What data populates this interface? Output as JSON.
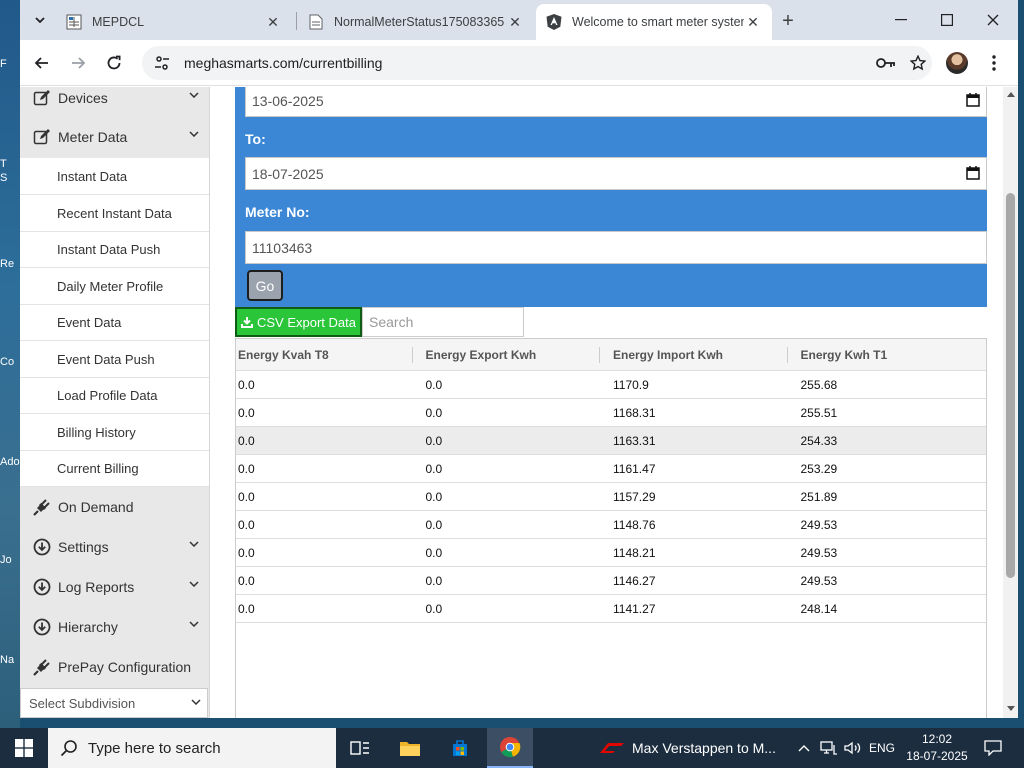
{
  "browser": {
    "tabs": [
      {
        "title": "MEPDCL"
      },
      {
        "title": "NormalMeterStatus175083365"
      },
      {
        "title": "Welcome to smart meter system"
      }
    ],
    "url": "meghasmarts.com/currentbilling"
  },
  "sidebar": {
    "items_top": [
      {
        "label": "Devices",
        "icon": "edit-icon"
      },
      {
        "label": "Meter Data",
        "icon": "edit-icon"
      }
    ],
    "submenu": [
      {
        "label": "Instant Data"
      },
      {
        "label": "Recent Instant Data"
      },
      {
        "label": "Instant Data Push"
      },
      {
        "label": "Daily Meter Profile"
      },
      {
        "label": "Event Data"
      },
      {
        "label": "Event Data Push"
      },
      {
        "label": "Load Profile Data"
      },
      {
        "label": "Billing History"
      },
      {
        "label": "Current Billing"
      }
    ],
    "items_bottom": [
      {
        "label": "On Demand",
        "icon": "plug-icon"
      },
      {
        "label": "Settings",
        "icon": "download-circle-icon"
      },
      {
        "label": "Log Reports",
        "icon": "download-circle-icon"
      },
      {
        "label": "Hierarchy",
        "icon": "download-circle-icon"
      },
      {
        "label": "PrePay Configuration",
        "icon": "plug-icon"
      }
    ],
    "select_subdivision": "Select Subdivision"
  },
  "form": {
    "from_value": "13-06-2025",
    "to_label": "To:",
    "to_value": "18-07-2025",
    "meter_label": "Meter No:",
    "meter_value": "11103463",
    "go_label": "Go"
  },
  "toolbar": {
    "csv_label": "CSV Export Data",
    "search_placeholder": "Search"
  },
  "table": {
    "columns": [
      "Energy Kvah T8",
      "Energy Export Kwh",
      "Energy Import Kwh",
      "Energy Kwh T1"
    ],
    "rows": [
      [
        "0.0",
        "0.0",
        "1170.9",
        "255.68"
      ],
      [
        "0.0",
        "0.0",
        "1168.31",
        "255.51"
      ],
      [
        "0.0",
        "0.0",
        "1163.31",
        "254.33"
      ],
      [
        "0.0",
        "0.0",
        "1161.47",
        "253.29"
      ],
      [
        "0.0",
        "0.0",
        "1157.29",
        "251.89"
      ],
      [
        "0.0",
        "0.0",
        "1148.76",
        "249.53"
      ],
      [
        "0.0",
        "0.0",
        "1148.21",
        "249.53"
      ],
      [
        "0.0",
        "0.0",
        "1146.27",
        "249.53"
      ],
      [
        "0.0",
        "0.0",
        "1141.27",
        "248.14"
      ]
    ],
    "highlighted_row": 2
  },
  "desktop": {
    "labels": [
      "F",
      "T",
      "S",
      "Re",
      "Co",
      "Ado",
      "Jo",
      "Na"
    ]
  },
  "taskbar": {
    "search_placeholder": "Type here to search",
    "news": "Max Verstappen to M...",
    "language": "ENG",
    "time": "12:02",
    "date": "18-07-2025"
  },
  "colors": {
    "form_blue": "#3b87d6",
    "csv_green": "#2bc53a",
    "sidebar_bg": "#e8e8e8"
  }
}
